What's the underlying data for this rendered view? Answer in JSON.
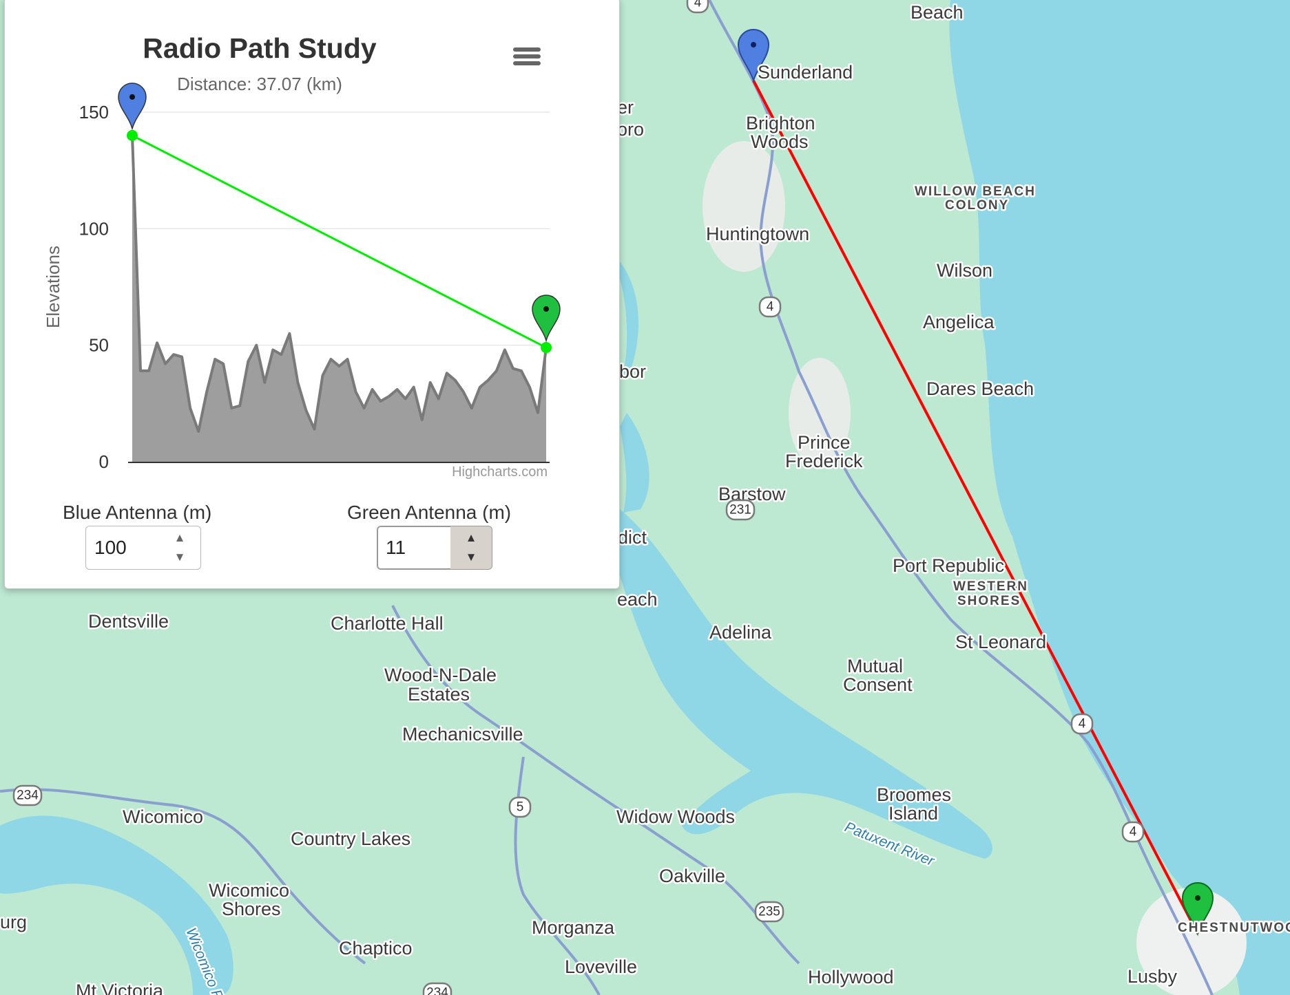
{
  "map": {
    "labels": [
      {
        "text": "Beach",
        "cls": ""
      },
      {
        "text": "Sunderland",
        "cls": ""
      },
      {
        "text": "Brighton",
        "cls": ""
      },
      {
        "text": "Woods",
        "cls": ""
      },
      {
        "text": "WILLOW BEACH",
        "cls": "caps"
      },
      {
        "text": "COLONY",
        "cls": "caps"
      },
      {
        "text": "Huntingtown",
        "cls": ""
      },
      {
        "text": "Wilson",
        "cls": ""
      },
      {
        "text": "Angelica",
        "cls": ""
      },
      {
        "text": "Dares Beach",
        "cls": ""
      },
      {
        "text": "Prince",
        "cls": ""
      },
      {
        "text": "Frederick",
        "cls": ""
      },
      {
        "text": "Barstow",
        "cls": ""
      },
      {
        "text": "Port Republic",
        "cls": ""
      },
      {
        "text": "WESTERN",
        "cls": "caps"
      },
      {
        "text": "SHORES",
        "cls": "caps"
      },
      {
        "text": "Adelina",
        "cls": ""
      },
      {
        "text": "St Leonard",
        "cls": ""
      },
      {
        "text": "Mutual",
        "cls": ""
      },
      {
        "text": "Consent",
        "cls": ""
      },
      {
        "text": "Dentsville",
        "cls": ""
      },
      {
        "text": "Charlotte Hall",
        "cls": ""
      },
      {
        "text": "Wood-N-Dale",
        "cls": ""
      },
      {
        "text": "Estates",
        "cls": ""
      },
      {
        "text": "Mechanicsville",
        "cls": ""
      },
      {
        "text": "Broomes",
        "cls": ""
      },
      {
        "text": "Island",
        "cls": ""
      },
      {
        "text": "Wicomico",
        "cls": ""
      },
      {
        "text": "Country Lakes",
        "cls": ""
      },
      {
        "text": "Widow Woods",
        "cls": ""
      },
      {
        "text": "Patuxent River",
        "cls": "water"
      },
      {
        "text": "Oakville",
        "cls": ""
      },
      {
        "text": "Wicomico",
        "cls": ""
      },
      {
        "text": "Shores",
        "cls": ""
      },
      {
        "text": "Chaptico",
        "cls": ""
      },
      {
        "text": "Morganza",
        "cls": ""
      },
      {
        "text": "Loveville",
        "cls": ""
      },
      {
        "text": "Hollywood",
        "cls": ""
      },
      {
        "text": "Mt Victoria",
        "cls": ""
      },
      {
        "text": "Lusby",
        "cls": ""
      },
      {
        "text": "CHESTNUTWOOD",
        "cls": "caps"
      },
      {
        "text": "Wicomico River",
        "cls": "water"
      },
      {
        "text": "urg",
        "cls": ""
      },
      {
        "text": "er",
        "cls": ""
      },
      {
        "text": "oro",
        "cls": ""
      },
      {
        "text": "rbor",
        "cls": ""
      },
      {
        "text": "edict",
        "cls": ""
      },
      {
        "text": "each",
        "cls": ""
      }
    ],
    "shields": [
      "4",
      "4",
      "231",
      "4",
      "4",
      "5",
      "234",
      "235",
      "234"
    ],
    "path_color": "#ff0000",
    "blue_marker_color": "#4f7fe0",
    "green_marker_color": "#1fbf3f"
  },
  "panel": {
    "title": "Radio Path Study",
    "subtitle": "Distance: 37.07 (km)",
    "menu_icon": "hamburger-menu-icon",
    "credits": "Highcharts.com",
    "blue_antenna": {
      "label": "Blue Antenna (m)",
      "value": "100"
    },
    "green_antenna": {
      "label": "Green Antenna (m)",
      "value": "11"
    }
  },
  "chart_data": {
    "type": "area",
    "title": "Radio Path Study",
    "subtitle": "Distance: 37.07 (km)",
    "ylabel": "Elevations",
    "xlabel": "",
    "ylim": [
      0,
      150
    ],
    "yticks": [
      "0",
      "50",
      "100",
      "150"
    ],
    "grid": true,
    "series": [
      {
        "name": "",
        "type": "area",
        "color": "#9e9e9e",
        "values": [
          140,
          39,
          39,
          51,
          42,
          46,
          45,
          23,
          13,
          30,
          44,
          42,
          23,
          24,
          43,
          50,
          34,
          48,
          46,
          55,
          34,
          22,
          14,
          37,
          44,
          41,
          44,
          30,
          23,
          31,
          26,
          28,
          31,
          27,
          32,
          18,
          34,
          27,
          38,
          35,
          30,
          23,
          32,
          35,
          39,
          48,
          40,
          39,
          32,
          21,
          49
        ]
      },
      {
        "name": "",
        "type": "line",
        "color": "#00ee00",
        "x": [
          0,
          50
        ],
        "values": [
          140,
          49
        ]
      }
    ],
    "markers": [
      {
        "position": "start",
        "color": "#4f7fe0"
      },
      {
        "position": "end",
        "color": "#1fbf3f"
      }
    ]
  }
}
